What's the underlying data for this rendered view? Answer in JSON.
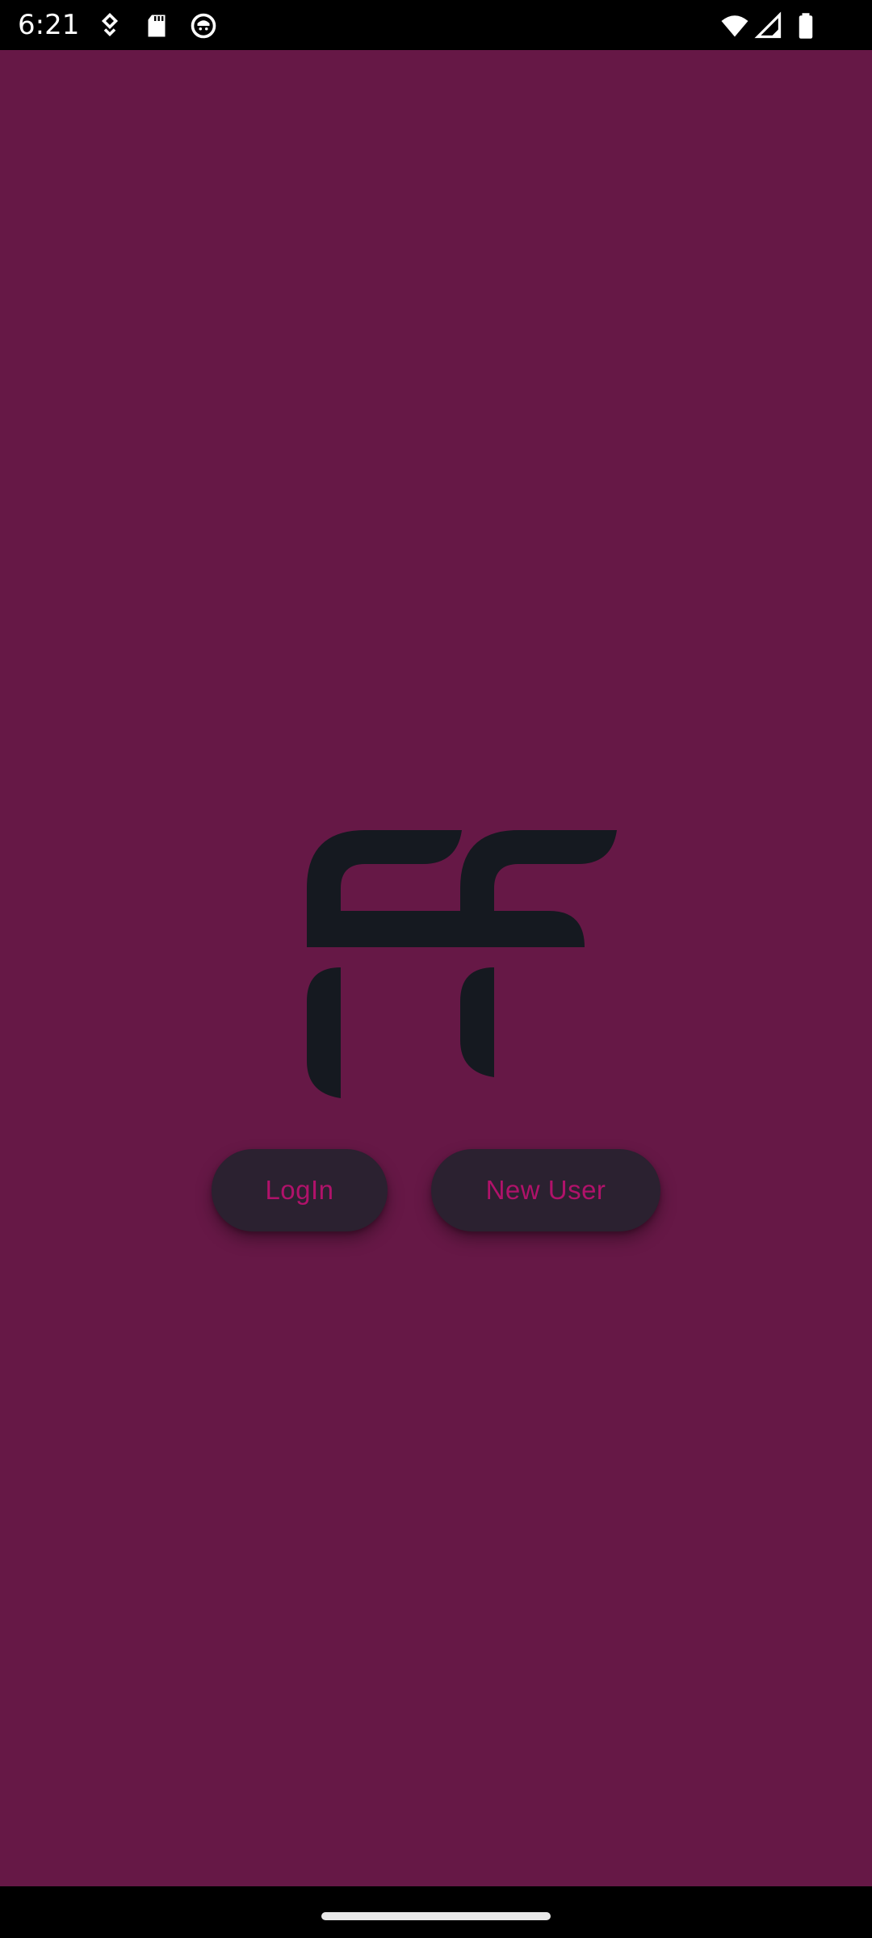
{
  "status_bar": {
    "time": "6:21",
    "icons_left": [
      "location-pin-icon",
      "sd-card-icon",
      "app-face-icon"
    ],
    "icons_right": [
      "wifi-icon",
      "signal-icon",
      "battery-icon"
    ]
  },
  "app": {
    "background_color": "#661846",
    "logo": "ff-logo",
    "buttons": {
      "login_label": "LogIn",
      "new_user_label": "New User"
    },
    "button_background": "#2b2130",
    "button_text_color": "#b0126a"
  },
  "nav_bar": {
    "home_indicator": "home-pill"
  }
}
